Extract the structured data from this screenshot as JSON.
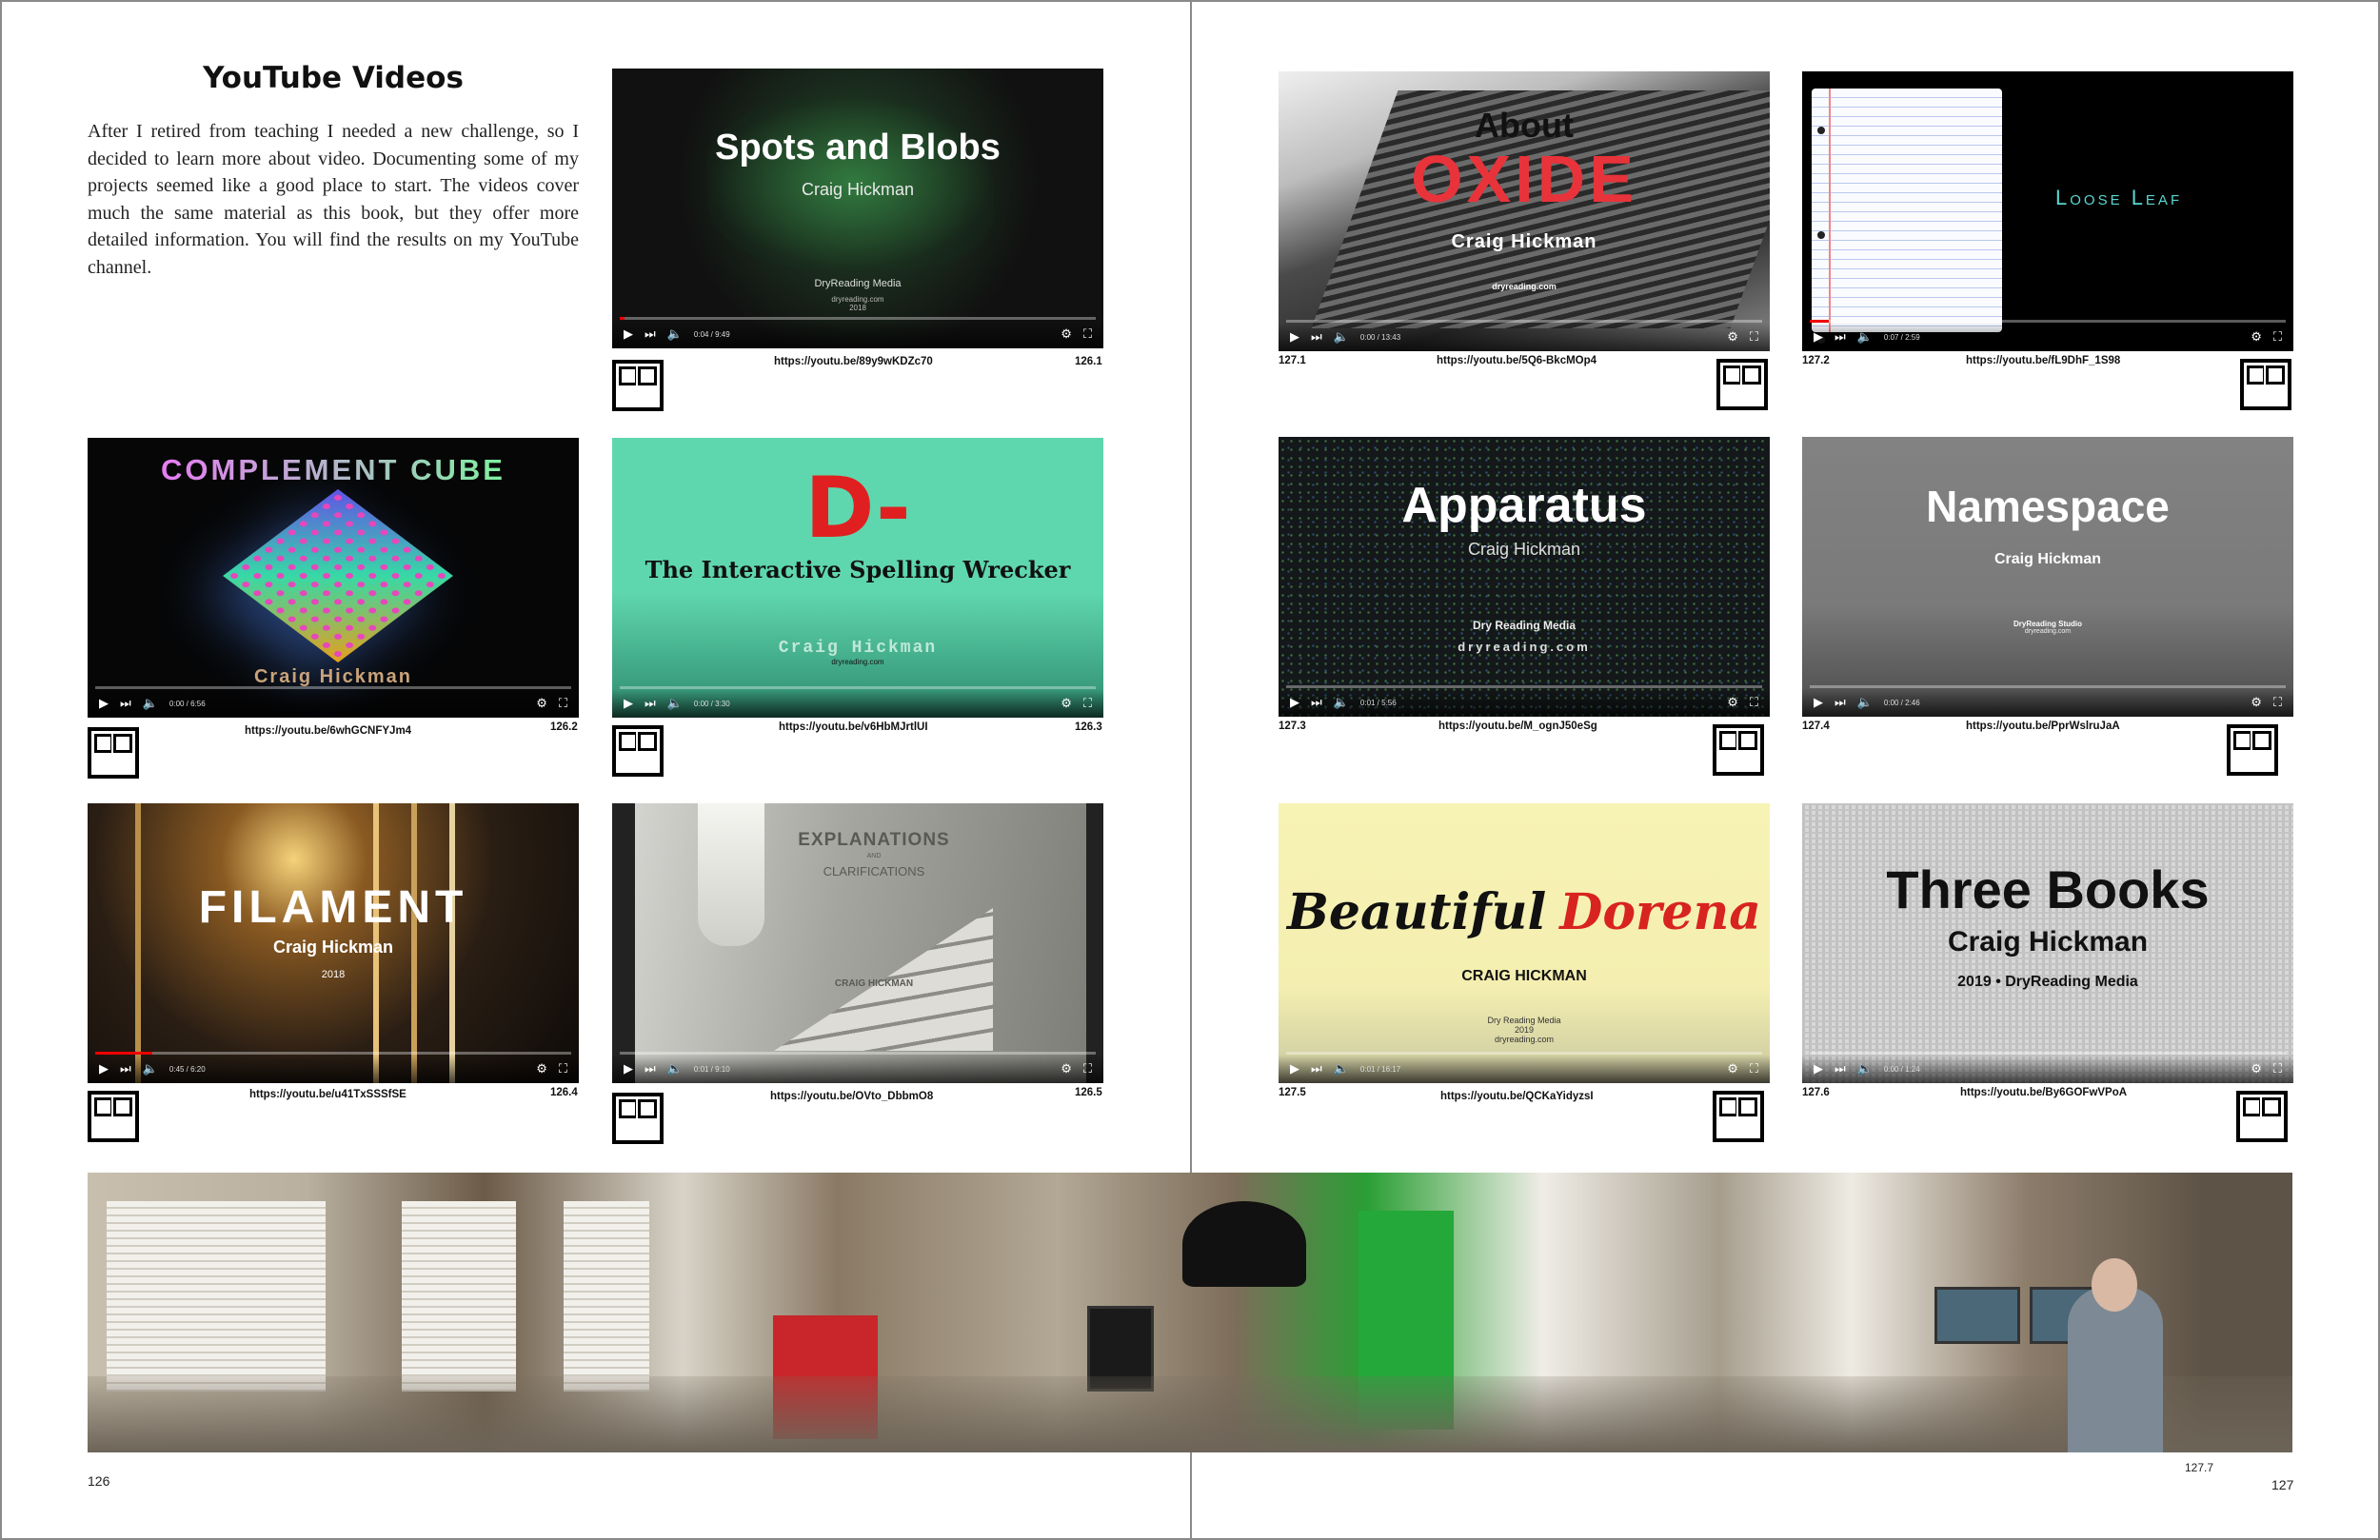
{
  "page": {
    "title": "YouTube Videos",
    "intro": "After I retired from teaching I needed a new challenge, so I decided to learn more about video. Documenting some of my projects seemed like a good place to start. The videos cover much the same material as this book, but they offer more detailed information. You will find the results on my YouTube channel.",
    "left_page_number": "126",
    "right_page_number": "127",
    "panorama_caption": "127.7"
  },
  "videos": [
    {
      "id": "126.1",
      "url": "https://youtu.be/89y9wKDZc70",
      "title": "Spots and Blobs",
      "author": "Craig Hickman",
      "footer1": "DryReading Media",
      "footer2": "dryreading.com",
      "footer3": "2018",
      "time": "0:04 / 9:49",
      "colors": {
        "bg": "#1a1a1a",
        "title": "#ffffff"
      }
    },
    {
      "id": "126.2",
      "url": "https://youtu.be/6whGCNFYJm4",
      "title": "COMPLEMENT CUBE",
      "author": "Craig Hickman",
      "time": "0:00 / 6:56",
      "colors": {
        "bg": "#050505",
        "title": "#e9a8f3"
      }
    },
    {
      "id": "126.3",
      "url": "https://youtu.be/v6HbMJrtlUI",
      "title": "D-",
      "subtitle": "The Interactive Spelling Wrecker",
      "author": "Craig Hickman",
      "footer1": "dryreading.com",
      "time": "0:00 / 3:30",
      "colors": {
        "bg": "#5fd7ae",
        "title": "#e02020"
      }
    },
    {
      "id": "126.4",
      "url": "https://youtu.be/u41TxSSSfSE",
      "title": "FILAMENT",
      "author": "Craig Hickman",
      "footer1": "2018",
      "time": "0:45 / 6:20",
      "colors": {
        "bg": "#2a2018",
        "title": "#ffffff"
      }
    },
    {
      "id": "126.5",
      "url": "https://youtu.be/OVto_DbbmO8",
      "title": "EXPLANATIONS",
      "title_and": "AND",
      "subtitle": "CLARIFICATIONS",
      "author": "CRAIG HICKMAN",
      "time": "0:01 / 9:10",
      "colors": {
        "bg": "#9a9a95",
        "title": "#5a5a55"
      }
    },
    {
      "id": "127.1",
      "url": "https://youtu.be/5Q6-BkcMOp4",
      "title_top": "About",
      "title": "OXIDE",
      "author": "Craig Hickman",
      "footer1": "dryreading.com",
      "time": "0:00 / 13:43",
      "colors": {
        "bg": "#6b6b6b",
        "title": "#e8333a"
      }
    },
    {
      "id": "127.2",
      "url": "https://youtu.be/fL9DhF_1S98",
      "title": "Loose Leaf",
      "time": "0:07 / 2:59",
      "colors": {
        "bg": "#000000",
        "title": "#5ad6d0"
      }
    },
    {
      "id": "127.3",
      "url": "https://youtu.be/M_ognJ50eSg",
      "title": "Apparatus",
      "author": "Craig Hickman",
      "footer1": "Dry Reading Media",
      "footer2": "dryreading.com",
      "time": "0:01 / 5:56",
      "colors": {
        "bg": "#14181a",
        "title": "#ffffff"
      }
    },
    {
      "id": "127.4",
      "url": "https://youtu.be/PprWslruJaA",
      "title": "Namespace",
      "author": "Craig Hickman",
      "footer1": "DryReading Studio",
      "footer2": "dryreading.com",
      "time": "0:00 / 2:46",
      "colors": {
        "bg": "#808080",
        "title": "#ffffff"
      }
    },
    {
      "id": "127.5",
      "url": "https://youtu.be/QCKaYidyzsI",
      "title_a": "Beautiful",
      "title_b": "Dorena",
      "author": "CRAIG HICKMAN",
      "footer1": "Dry Reading Media",
      "footer2": "2019",
      "footer3": "dryreading.com",
      "time": "0:01 / 16:17",
      "colors": {
        "bg": "#f6f2b0",
        "title_a": "#111111",
        "title_b": "#d8241e"
      }
    },
    {
      "id": "127.6",
      "url": "https://youtu.be/By6GOFwVPoA",
      "title": "Three Books",
      "author": "Craig Hickman",
      "footer1": "2019 • DryReading Media",
      "time": "0:00 / 1:24",
      "colors": {
        "bg": "#d6d6d6",
        "title": "#111111"
      }
    }
  ]
}
